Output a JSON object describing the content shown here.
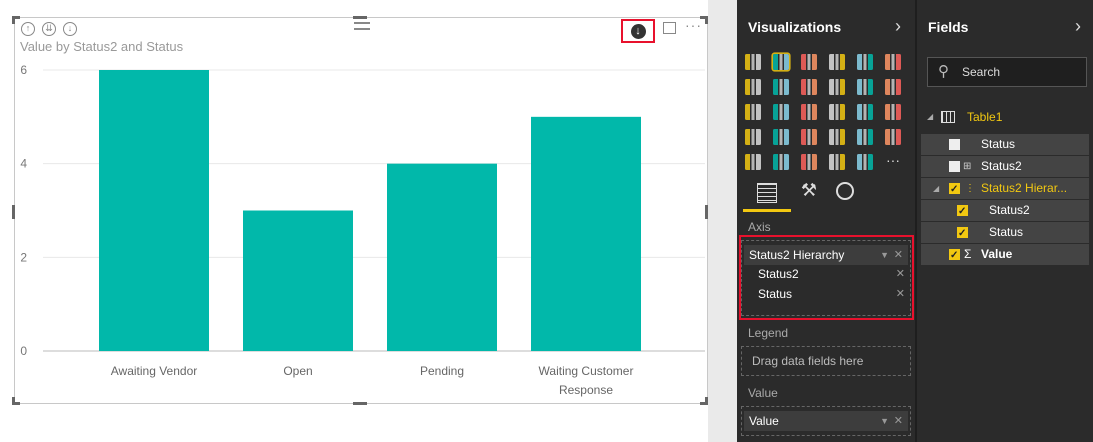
{
  "visual": {
    "title": "Value by Status2 and Status"
  },
  "chart_data": {
    "type": "bar",
    "title": "Value by Status2 and Status",
    "categories": [
      "Awaiting Vendor",
      "Open",
      "Pending",
      "Waiting Customer Response"
    ],
    "category_lines": [
      [
        "Awaiting Vendor"
      ],
      [
        "Open"
      ],
      [
        "Pending"
      ],
      [
        "Waiting Customer",
        "Response"
      ]
    ],
    "values": [
      6,
      3,
      4,
      5
    ],
    "yticks": [
      "0",
      "2",
      "4",
      "6"
    ],
    "ylim": [
      0,
      6
    ],
    "grid": true,
    "bar_color": "#01b8aa"
  },
  "viz_pane": {
    "title": "Visualizations",
    "sections": {
      "axis": "Axis",
      "legend": "Legend",
      "value": "Value"
    },
    "axis_well": {
      "field": "Status2 Hierarchy",
      "levels": [
        "Status2",
        "Status"
      ]
    },
    "legend_placeholder": "Drag data fields here",
    "value_well": "Value"
  },
  "fields_pane": {
    "title": "Fields",
    "search_placeholder": "Search",
    "table_name": "Table1",
    "fields": [
      {
        "label": "Status",
        "checked": false
      },
      {
        "label": "Status2",
        "checked": false
      },
      {
        "label": "Status2 Hierar...",
        "checked": true
      },
      {
        "label": "Status2",
        "checked": true
      },
      {
        "label": "Status",
        "checked": true
      },
      {
        "label": "Value",
        "checked": true
      }
    ]
  },
  "colors": {
    "accent": "#f2c811",
    "highlight": "#e8112d",
    "bar": "#01b8aa"
  }
}
